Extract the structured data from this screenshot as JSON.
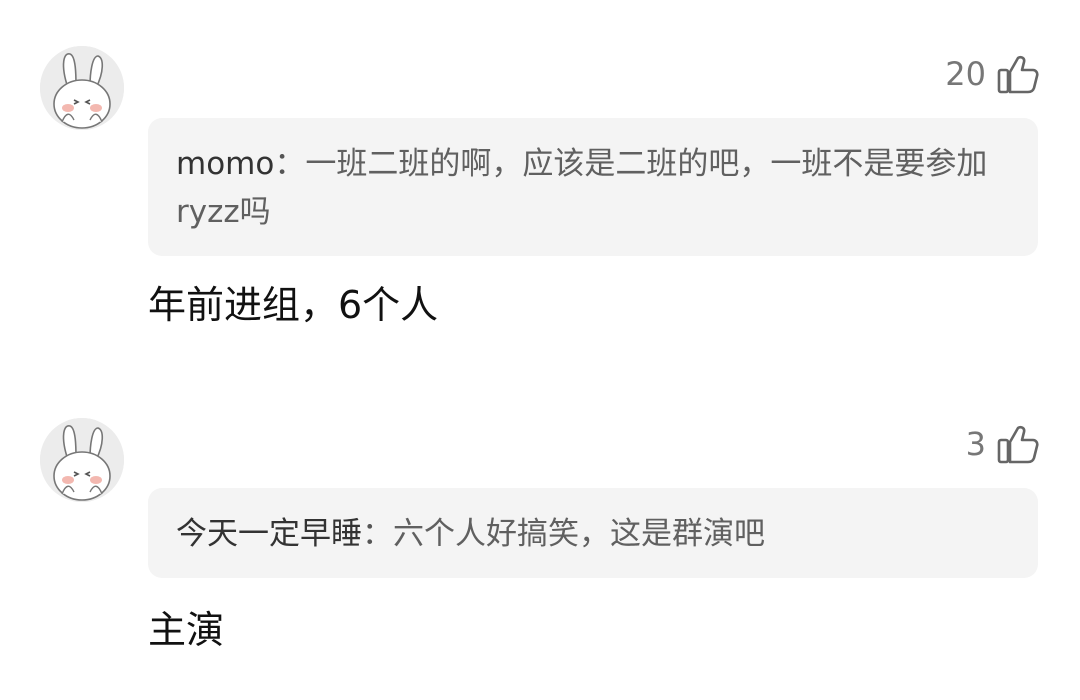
{
  "comments": [
    {
      "likes": "20",
      "quote": {
        "author": "momo",
        "separator": "：",
        "text": "一班二班的啊，应该是二班的吧，一班不是要参加ryzz吗"
      },
      "reply": "年前进组，6个人"
    },
    {
      "likes": "3",
      "quote": {
        "author": "今天一定早睡",
        "separator": "：",
        "text": "六个人好搞笑，这是群演吧"
      },
      "reply": "主演"
    }
  ],
  "icons": {
    "avatar": "bunny-avatar-icon",
    "like": "thumbs-up-icon"
  }
}
